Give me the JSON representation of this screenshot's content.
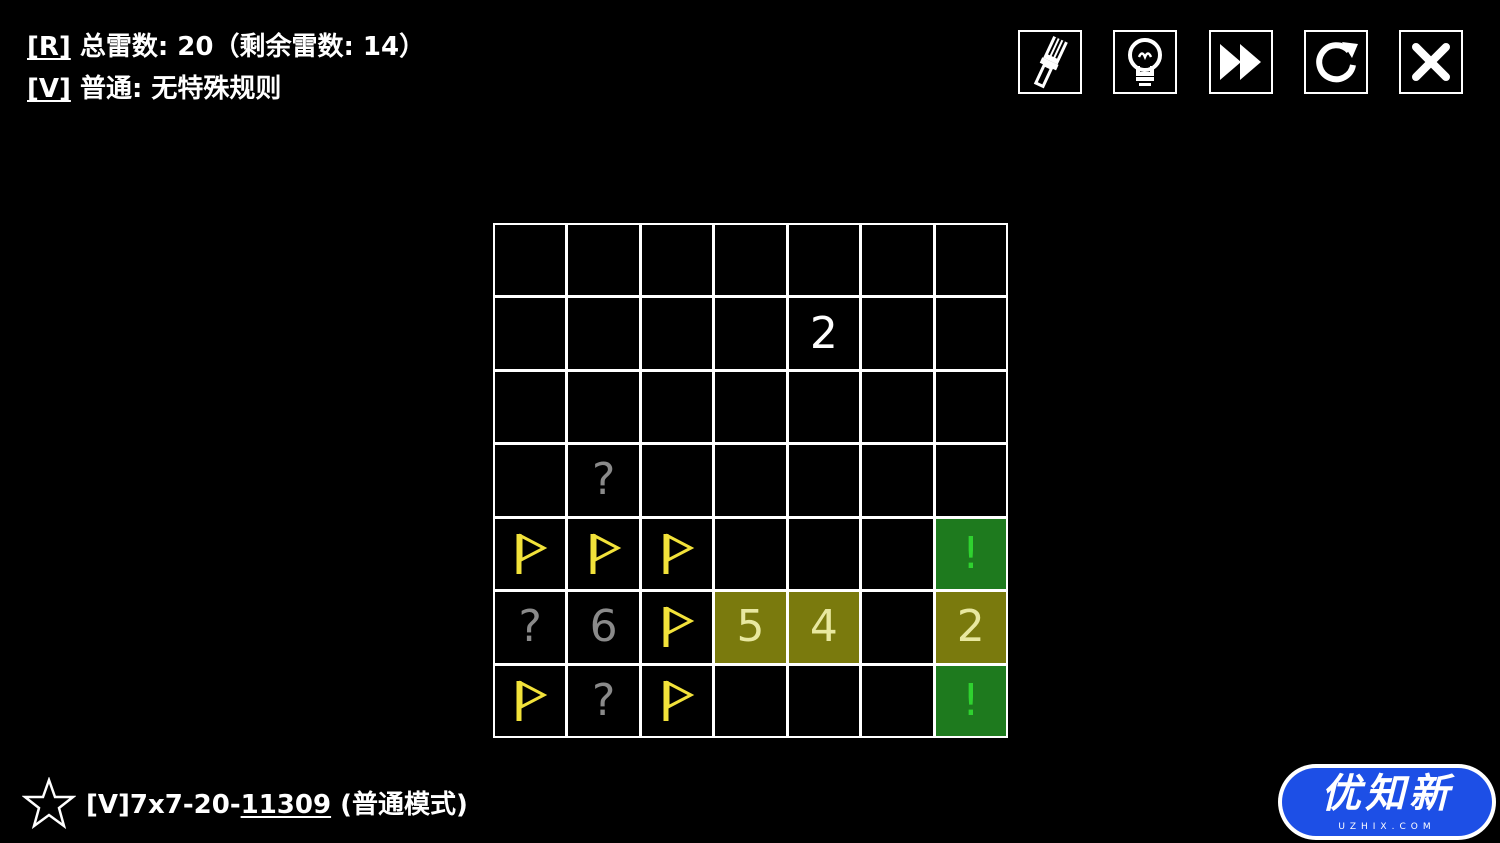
{
  "rules": {
    "line1_prefix": "[R]",
    "line1_text": " 总雷数:  20（剩余雷数: 14）",
    "line2_prefix": "[V]",
    "line2_text": " 普通: 无特殊规则"
  },
  "toolbar": [
    {
      "name": "brush-button",
      "icon": "brush-icon"
    },
    {
      "name": "hint-button",
      "icon": "lightbulb-icon"
    },
    {
      "name": "skip-button",
      "icon": "fast-forward-icon"
    },
    {
      "name": "restart-button",
      "icon": "refresh-icon"
    },
    {
      "name": "close-button",
      "icon": "close-icon"
    }
  ],
  "board": {
    "rows": 7,
    "cols": 7,
    "cells": [
      {
        "r": 1,
        "c": 4,
        "type": "number",
        "value": "2",
        "color": "#ffffff"
      },
      {
        "r": 3,
        "c": 1,
        "type": "unknown",
        "value": "?"
      },
      {
        "r": 4,
        "c": 0,
        "type": "flag"
      },
      {
        "r": 4,
        "c": 1,
        "type": "flag"
      },
      {
        "r": 4,
        "c": 2,
        "type": "flag"
      },
      {
        "r": 4,
        "c": 6,
        "type": "safe",
        "value": "!"
      },
      {
        "r": 5,
        "c": 0,
        "type": "unknown",
        "value": "?"
      },
      {
        "r": 5,
        "c": 1,
        "type": "number",
        "value": "6",
        "color": "#8a8a8a"
      },
      {
        "r": 5,
        "c": 2,
        "type": "flag"
      },
      {
        "r": 5,
        "c": 3,
        "type": "number",
        "value": "5",
        "color": "#e8e8a0",
        "highlight": true
      },
      {
        "r": 5,
        "c": 4,
        "type": "number",
        "value": "4",
        "color": "#e8e8a0",
        "highlight": true
      },
      {
        "r": 5,
        "c": 6,
        "type": "number",
        "value": "2",
        "color": "#e8e8a0",
        "highlight": true
      },
      {
        "r": 6,
        "c": 0,
        "type": "flag"
      },
      {
        "r": 6,
        "c": 1,
        "type": "unknown",
        "value": "?"
      },
      {
        "r": 6,
        "c": 2,
        "type": "flag"
      },
      {
        "r": 6,
        "c": 6,
        "type": "safe",
        "value": "!"
      }
    ]
  },
  "footer": {
    "star_icon": "star-outline-icon",
    "label_prefix": "[V]7x7-20-",
    "label_id": "11309",
    "label_suffix": " (普通模式)"
  },
  "watermark": {
    "title": "优知新",
    "subtitle": "UZHIX.COM"
  },
  "colors": {
    "flag": "#f2e23a",
    "highlight": "#7a7a0d",
    "safe_bg": "#1e7a1e",
    "safe_mark": "#2fd22f",
    "watermark_blue": "#1d4fe6"
  }
}
